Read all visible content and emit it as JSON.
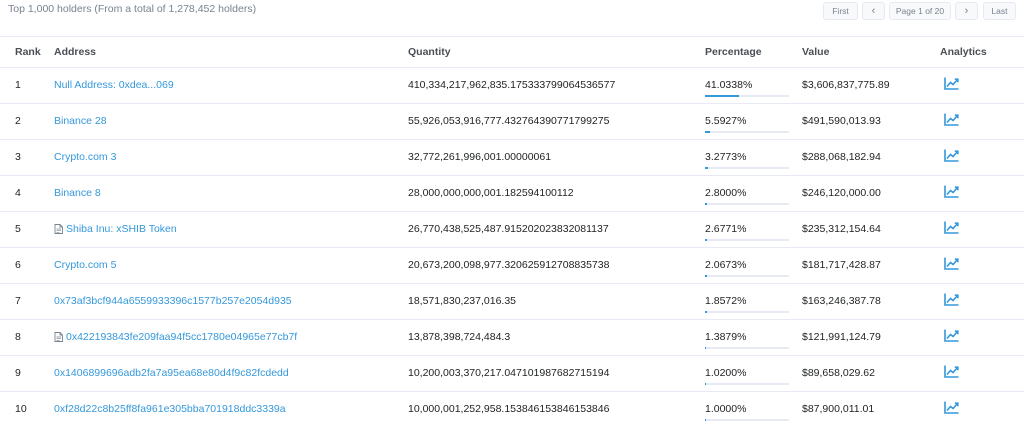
{
  "summary": "Top 1,000 holders (From a total of 1,278,452 holders)",
  "pagination": {
    "first": "First",
    "prev": "‹",
    "page": "Page 1 of 20",
    "next": "›",
    "last": "Last"
  },
  "columns": {
    "rank": "Rank",
    "address": "Address",
    "quantity": "Quantity",
    "percentage": "Percentage",
    "value": "Value",
    "analytics": "Analytics"
  },
  "colors": {
    "link": "#3498db",
    "bar": "#3498db",
    "border": "#e7eaf3"
  },
  "rows": [
    {
      "rank": "1",
      "address": "Null Address: 0xdea...069",
      "contract": false,
      "quantity": "410,334,217,962,835.175333799064536577",
      "percentage": "41.0338%",
      "pct_value": 41.0338,
      "value": "$3,606,837,775.89",
      "icon": "chart-icon"
    },
    {
      "rank": "2",
      "address": "Binance 28",
      "contract": false,
      "quantity": "55,926,053,916,777.432764390771799275",
      "percentage": "5.5927%",
      "pct_value": 5.5927,
      "value": "$491,590,013.93",
      "icon": "chart-icon"
    },
    {
      "rank": "3",
      "address": "Crypto.com 3",
      "contract": false,
      "quantity": "32,772,261,996,001.00000061",
      "percentage": "3.2773%",
      "pct_value": 3.2773,
      "value": "$288,068,182.94",
      "icon": "chart-icon"
    },
    {
      "rank": "4",
      "address": "Binance 8",
      "contract": false,
      "quantity": "28,000,000,000,001.182594100112",
      "percentage": "2.8000%",
      "pct_value": 2.8,
      "value": "$246,120,000.00",
      "icon": "chart-icon"
    },
    {
      "rank": "5",
      "address": "Shiba Inu: xSHIB Token",
      "contract": true,
      "quantity": "26,770,438,525,487.915202023832081137",
      "percentage": "2.6771%",
      "pct_value": 2.6771,
      "value": "$235,312,154.64",
      "icon": "chart-icon"
    },
    {
      "rank": "6",
      "address": "Crypto.com 5",
      "contract": false,
      "quantity": "20,673,200,098,977.320625912708835738",
      "percentage": "2.0673%",
      "pct_value": 2.0673,
      "value": "$181,717,428.87",
      "icon": "chart-icon"
    },
    {
      "rank": "7",
      "address": "0x73af3bcf944a6559933396c1577b257e2054d935",
      "contract": false,
      "quantity": "18,571,830,237,016.35",
      "percentage": "1.8572%",
      "pct_value": 1.8572,
      "value": "$163,246,387.78",
      "icon": "chart-icon"
    },
    {
      "rank": "8",
      "address": "0x422193843fe209faa94f5cc1780e04965e77cb7f",
      "contract": true,
      "quantity": "13,878,398,724,484.3",
      "percentage": "1.3879%",
      "pct_value": 1.3879,
      "value": "$121,991,124.79",
      "icon": "chart-icon"
    },
    {
      "rank": "9",
      "address": "0x1406899696adb2fa7a95ea68e80d4f9c82fcdedd",
      "contract": false,
      "quantity": "10,200,003,370,217.047101987682715194",
      "percentage": "1.0200%",
      "pct_value": 1.02,
      "value": "$89,658,029.62",
      "icon": "chart-icon"
    },
    {
      "rank": "10",
      "address": "0xf28d22c8b25ff8fa961e305bba701918ddc3339a",
      "contract": false,
      "quantity": "10,000,001,252,958.153846153846153846",
      "percentage": "1.0000%",
      "pct_value": 1.0,
      "value": "$87,900,011.01",
      "icon": "chart-icon"
    }
  ]
}
